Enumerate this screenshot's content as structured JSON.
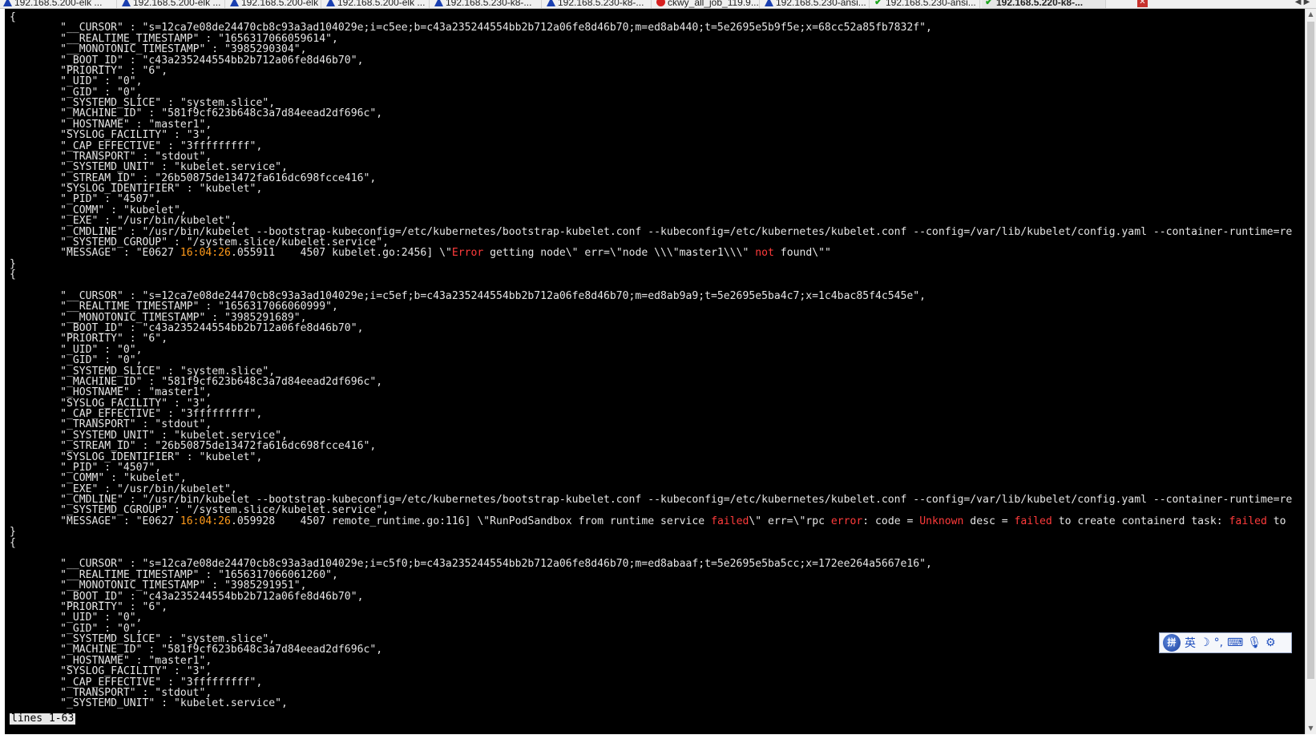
{
  "tabs": [
    {
      "label": "192.168.5.200-elk ...",
      "status": "warn",
      "active": false
    },
    {
      "label": "192.168.5.200-elk ...",
      "status": "warn",
      "active": false
    },
    {
      "label": "192.168.5.200-elk",
      "status": "warn",
      "active": false
    },
    {
      "label": "192.168.5.200-elk ...",
      "status": "warn",
      "active": false
    },
    {
      "label": "192.168.5.230-k8-...",
      "status": "warn",
      "active": false
    },
    {
      "label": "192.168.5.230-k8-...",
      "status": "warn",
      "active": false
    },
    {
      "label": "ckwy_all_job_119.9...",
      "status": "error",
      "active": false
    },
    {
      "label": "192.168.5.230-ansi...",
      "status": "warn",
      "active": false
    },
    {
      "label": "192.168.5.230-ansi...",
      "status": "ok",
      "active": false
    },
    {
      "label": "192.168.5.220-k8-...",
      "status": "ok",
      "active": true
    }
  ],
  "tab_close_icon": "close-icon",
  "tab_overflow_icon": "chevron-icon",
  "terminal": {
    "lines": [
      [
        {
          "t": "{"
        }
      ],
      [
        {
          "t": "        \"__CURSOR\" : \"s=12ca7e08de24470cb8c93a3ad104029e;i=c5ee;b=c43a235244554bb2b712a06fe8d46b70;m=ed8ab440;t=5e2695e5b9f5e;x=68cc52a85fb7832f\","
        }
      ],
      [
        {
          "t": "        \"__REALTIME_TIMESTAMP\" : \"1656317066059614\","
        }
      ],
      [
        {
          "t": "        \"__MONOTONIC_TIMESTAMP\" : \"3985290304\","
        }
      ],
      [
        {
          "t": "        \"_BOOT_ID\" : \"c43a235244554bb2b712a06fe8d46b70\","
        }
      ],
      [
        {
          "t": "        \"PRIORITY\" : \"6\","
        }
      ],
      [
        {
          "t": "        \"_UID\" : \"0\","
        }
      ],
      [
        {
          "t": "        \"_GID\" : \"0\","
        }
      ],
      [
        {
          "t": "        \"_SYSTEMD_SLICE\" : \"system.slice\","
        }
      ],
      [
        {
          "t": "        \"_MACHINE_ID\" : \"581f9cf623b648c3a7d84eead2df696c\","
        }
      ],
      [
        {
          "t": "        \"_HOSTNAME\" : \"master1\","
        }
      ],
      [
        {
          "t": "        \"SYSLOG_FACILITY\" : \"3\","
        }
      ],
      [
        {
          "t": "        \"_CAP_EFFECTIVE\" : \"3fffffffff\","
        }
      ],
      [
        {
          "t": "        \"_TRANSPORT\" : \"stdout\","
        }
      ],
      [
        {
          "t": "        \"_SYSTEMD_UNIT\" : \"kubelet.service\","
        }
      ],
      [
        {
          "t": "        \"_STREAM_ID\" : \"26b50875de13472fa616dc698fcce416\","
        }
      ],
      [
        {
          "t": "        \"SYSLOG_IDENTIFIER\" : \"kubelet\","
        }
      ],
      [
        {
          "t": "        \"_PID\" : \"4507\","
        }
      ],
      [
        {
          "t": "        \"_COMM\" : \"kubelet\","
        }
      ],
      [
        {
          "t": "        \"_EXE\" : \"/usr/bin/kubelet\","
        }
      ],
      [
        {
          "t": "        \"_CMDLINE\" : \"/usr/bin/kubelet --bootstrap-kubeconfig=/etc/kubernetes/bootstrap-kubelet.conf --kubeconfig=/etc/kubernetes/kubelet.conf --config=/var/lib/kubelet/config.yaml --container-runtime=re"
        }
      ],
      [
        {
          "t": "        \"_SYSTEMD_CGROUP\" : \"/system.slice/kubelet.service\","
        }
      ],
      [
        {
          "t": "        \"MESSAGE\" : \"E0627 "
        },
        {
          "t": "16:04:26",
          "c": "ts"
        },
        {
          "t": ".055911    4507 kubelet.go:2456] \\\""
        },
        {
          "t": "Error",
          "c": "hl"
        },
        {
          "t": " getting node\\\" err=\\\"node \\\\\\\"master1\\\\\\\" "
        },
        {
          "t": "not",
          "c": "hl"
        },
        {
          "t": " found\\\"\""
        }
      ],
      [
        {
          "t": "}"
        }
      ],
      [
        {
          "t": "{"
        }
      ],
      [
        {
          "t": ""
        }
      ],
      [
        {
          "t": "        \"__CURSOR\" : \"s=12ca7e08de24470cb8c93a3ad104029e;i=c5ef;b=c43a235244554bb2b712a06fe8d46b70;m=ed8ab9a9;t=5e2695e5ba4c7;x=1c4bac85f4c545e\","
        }
      ],
      [
        {
          "t": "        \"__REALTIME_TIMESTAMP\" : \"1656317066060999\","
        }
      ],
      [
        {
          "t": "        \"__MONOTONIC_TIMESTAMP\" : \"3985291689\","
        }
      ],
      [
        {
          "t": "        \"_BOOT_ID\" : \"c43a235244554bb2b712a06fe8d46b70\","
        }
      ],
      [
        {
          "t": "        \"PRIORITY\" : \"6\","
        }
      ],
      [
        {
          "t": "        \"_UID\" : \"0\","
        }
      ],
      [
        {
          "t": "        \"_GID\" : \"0\","
        }
      ],
      [
        {
          "t": "        \"_SYSTEMD_SLICE\" : \"system.slice\","
        }
      ],
      [
        {
          "t": "        \"_MACHINE_ID\" : \"581f9cf623b648c3a7d84eead2df696c\","
        }
      ],
      [
        {
          "t": "        \"_HOSTNAME\" : \"master1\","
        }
      ],
      [
        {
          "t": "        \"SYSLOG_FACILITY\" : \"3\","
        }
      ],
      [
        {
          "t": "        \"_CAP_EFFECTIVE\" : \"3fffffffff\","
        }
      ],
      [
        {
          "t": "        \"_TRANSPORT\" : \"stdout\","
        }
      ],
      [
        {
          "t": "        \"_SYSTEMD_UNIT\" : \"kubelet.service\","
        }
      ],
      [
        {
          "t": "        \"_STREAM_ID\" : \"26b50875de13472fa616dc698fcce416\","
        }
      ],
      [
        {
          "t": "        \"SYSLOG_IDENTIFIER\" : \"kubelet\","
        }
      ],
      [
        {
          "t": "        \"_PID\" : \"4507\","
        }
      ],
      [
        {
          "t": "        \"_COMM\" : \"kubelet\","
        }
      ],
      [
        {
          "t": "        \"_EXE\" : \"/usr/bin/kubelet\","
        }
      ],
      [
        {
          "t": "        \"_CMDLINE\" : \"/usr/bin/kubelet --bootstrap-kubeconfig=/etc/kubernetes/bootstrap-kubelet.conf --kubeconfig=/etc/kubernetes/kubelet.conf --config=/var/lib/kubelet/config.yaml --container-runtime=re"
        }
      ],
      [
        {
          "t": "        \"_SYSTEMD_CGROUP\" : \"/system.slice/kubelet.service\","
        }
      ],
      [
        {
          "t": "        \"MESSAGE\" : \"E0627 "
        },
        {
          "t": "16:04:26",
          "c": "ts"
        },
        {
          "t": ".059928    4507 remote_runtime.go:116] \\\"RunPodSandbox from runtime service "
        },
        {
          "t": "failed",
          "c": "hl"
        },
        {
          "t": "\\\" err=\\\"rpc "
        },
        {
          "t": "error",
          "c": "hl"
        },
        {
          "t": ": code = "
        },
        {
          "t": "Unknown",
          "c": "hl"
        },
        {
          "t": " desc = "
        },
        {
          "t": "failed",
          "c": "hl"
        },
        {
          "t": " to create containerd task: "
        },
        {
          "t": "failed",
          "c": "hl"
        },
        {
          "t": " to"
        }
      ],
      [
        {
          "t": "}"
        }
      ],
      [
        {
          "t": "{"
        }
      ],
      [
        {
          "t": ""
        }
      ],
      [
        {
          "t": "        \"__CURSOR\" : \"s=12ca7e08de24470cb8c93a3ad104029e;i=c5f0;b=c43a235244554bb2b712a06fe8d46b70;m=ed8abaaf;t=5e2695e5ba5cc;x=172ee264a5667e16\","
        }
      ],
      [
        {
          "t": "        \"__REALTIME_TIMESTAMP\" : \"1656317066061260\","
        }
      ],
      [
        {
          "t": "        \"__MONOTONIC_TIMESTAMP\" : \"3985291951\","
        }
      ],
      [
        {
          "t": "        \"_BOOT_ID\" : \"c43a235244554bb2b712a06fe8d46b70\","
        }
      ],
      [
        {
          "t": "        \"PRIORITY\" : \"6\","
        }
      ],
      [
        {
          "t": "        \"_UID\" : \"0\","
        }
      ],
      [
        {
          "t": "        \"_GID\" : \"0\","
        }
      ],
      [
        {
          "t": "        \"_SYSTEMD_SLICE\" : \"system.slice\","
        }
      ],
      [
        {
          "t": "        \"_MACHINE_ID\" : \"581f9cf623b648c3a7d84eead2df696c\","
        }
      ],
      [
        {
          "t": "        \"_HOSTNAME\" : \"master1\","
        }
      ],
      [
        {
          "t": "        \"SYSLOG_FACILITY\" : \"3\","
        }
      ],
      [
        {
          "t": "        \"_CAP_EFFECTIVE\" : \"3fffffffff\","
        }
      ],
      [
        {
          "t": "        \"_TRANSPORT\" : \"stdout\","
        }
      ],
      [
        {
          "t": "        \"_SYSTEMD_UNIT\" : \"kubelet.service\","
        }
      ]
    ]
  },
  "status_line": "lines 1-63",
  "ime": {
    "logo_icon": "sogou-logo-icon",
    "logo_text": "拼",
    "lang": "英",
    "moon_icon": "moon-icon",
    "punct": "°,",
    "keyboard_icon": "keyboard-icon",
    "mic_icon": "microphone-icon",
    "settings_icon": "gear-icon"
  }
}
